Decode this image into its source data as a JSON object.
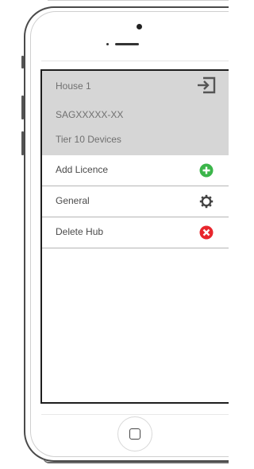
{
  "header": {
    "hub_name": "House 1",
    "hub_id": "SAGXXXXX-XX",
    "tier": "Tier 10 Devices",
    "exit_icon": "exit-icon"
  },
  "menu": [
    {
      "label": "Add Licence",
      "icon": "add-icon",
      "icon_color": "#3bb54a"
    },
    {
      "label": "General",
      "icon": "gear-icon",
      "icon_color": "#444444"
    },
    {
      "label": "Delete Hub",
      "icon": "delete-icon",
      "icon_color": "#e8262d"
    }
  ],
  "colors": {
    "header_bg": "#d6d6d6",
    "text_muted": "#707070",
    "add_green": "#3bb54a",
    "delete_red": "#e8262d"
  }
}
